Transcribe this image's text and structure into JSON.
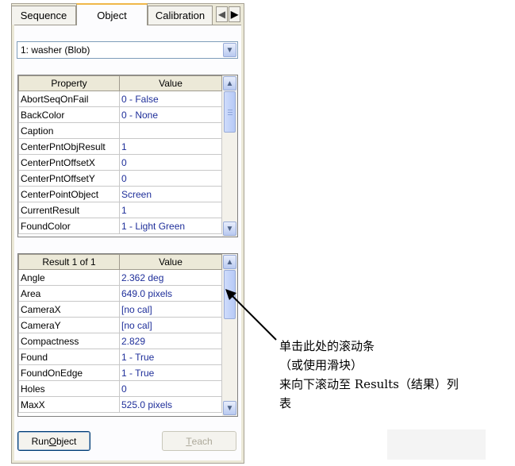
{
  "tabs": [
    {
      "label": "Sequence"
    },
    {
      "label": "Object"
    },
    {
      "label": "Calibration"
    }
  ],
  "object_select": {
    "value": "1:  washer (Blob)"
  },
  "properties": {
    "headers": [
      "Property",
      "Value"
    ],
    "rows": [
      {
        "name": "AbortSeqOnFail",
        "value": "0 - False"
      },
      {
        "name": "BackColor",
        "value": "0 - None"
      },
      {
        "name": "Caption",
        "value": ""
      },
      {
        "name": "CenterPntObjResult",
        "value": "1"
      },
      {
        "name": "CenterPntOffsetX",
        "value": "0"
      },
      {
        "name": "CenterPntOffsetY",
        "value": "0"
      },
      {
        "name": "CenterPointObject",
        "value": "Screen"
      },
      {
        "name": "CurrentResult",
        "value": "1"
      },
      {
        "name": "FoundColor",
        "value": "1 - Light Green"
      }
    ]
  },
  "results": {
    "headers": [
      "Result 1 of 1",
      "Value"
    ],
    "rows": [
      {
        "name": "Angle",
        "value": "2.362 deg"
      },
      {
        "name": "Area",
        "value": "649.0 pixels"
      },
      {
        "name": "CameraX",
        "value": "[no cal]"
      },
      {
        "name": "CameraY",
        "value": "[no cal]"
      },
      {
        "name": "Compactness",
        "value": "2.829"
      },
      {
        "name": "Found",
        "value": "1 - True"
      },
      {
        "name": "FoundOnEdge",
        "value": "1 - True"
      },
      {
        "name": "Holes",
        "value": "0"
      },
      {
        "name": "MaxX",
        "value": "525.0 pixels"
      }
    ]
  },
  "buttons": {
    "run_prefix": "Run ",
    "run_mnemonic": "O",
    "run_suffix": "bject",
    "teach_mnemonic": "T",
    "teach_suffix": "each"
  },
  "annotation": {
    "lines": [
      "单击此处的滚动条",
      "（或使用滑块）",
      "来向下滚动至 Results（结果）列",
      "表"
    ]
  }
}
